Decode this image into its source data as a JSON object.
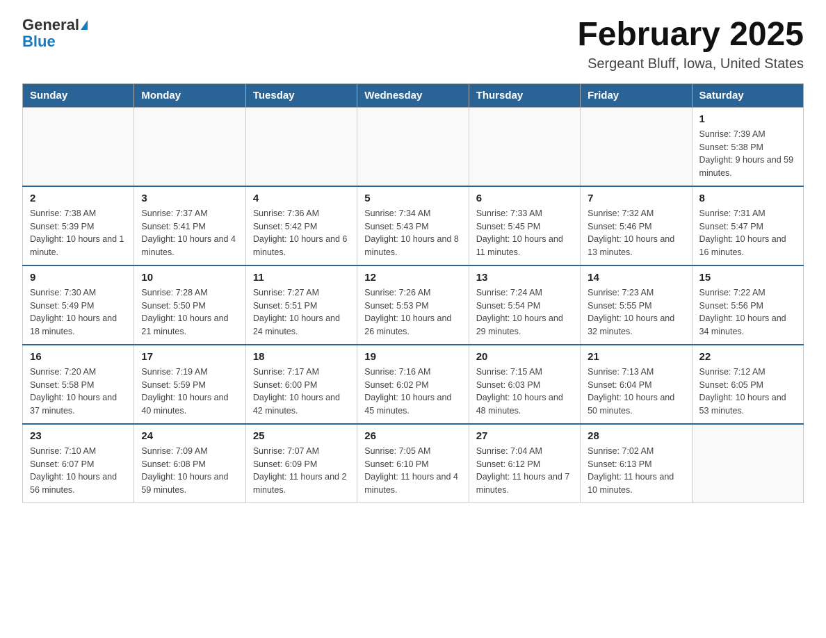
{
  "header": {
    "logo_line1": "General",
    "logo_line2": "Blue",
    "title": "February 2025",
    "subtitle": "Sergeant Bluff, Iowa, United States"
  },
  "calendar": {
    "days_of_week": [
      "Sunday",
      "Monday",
      "Tuesday",
      "Wednesday",
      "Thursday",
      "Friday",
      "Saturday"
    ],
    "weeks": [
      [
        {
          "day": "",
          "info": ""
        },
        {
          "day": "",
          "info": ""
        },
        {
          "day": "",
          "info": ""
        },
        {
          "day": "",
          "info": ""
        },
        {
          "day": "",
          "info": ""
        },
        {
          "day": "",
          "info": ""
        },
        {
          "day": "1",
          "info": "Sunrise: 7:39 AM\nSunset: 5:38 PM\nDaylight: 9 hours and 59 minutes."
        }
      ],
      [
        {
          "day": "2",
          "info": "Sunrise: 7:38 AM\nSunset: 5:39 PM\nDaylight: 10 hours and 1 minute."
        },
        {
          "day": "3",
          "info": "Sunrise: 7:37 AM\nSunset: 5:41 PM\nDaylight: 10 hours and 4 minutes."
        },
        {
          "day": "4",
          "info": "Sunrise: 7:36 AM\nSunset: 5:42 PM\nDaylight: 10 hours and 6 minutes."
        },
        {
          "day": "5",
          "info": "Sunrise: 7:34 AM\nSunset: 5:43 PM\nDaylight: 10 hours and 8 minutes."
        },
        {
          "day": "6",
          "info": "Sunrise: 7:33 AM\nSunset: 5:45 PM\nDaylight: 10 hours and 11 minutes."
        },
        {
          "day": "7",
          "info": "Sunrise: 7:32 AM\nSunset: 5:46 PM\nDaylight: 10 hours and 13 minutes."
        },
        {
          "day": "8",
          "info": "Sunrise: 7:31 AM\nSunset: 5:47 PM\nDaylight: 10 hours and 16 minutes."
        }
      ],
      [
        {
          "day": "9",
          "info": "Sunrise: 7:30 AM\nSunset: 5:49 PM\nDaylight: 10 hours and 18 minutes."
        },
        {
          "day": "10",
          "info": "Sunrise: 7:28 AM\nSunset: 5:50 PM\nDaylight: 10 hours and 21 minutes."
        },
        {
          "day": "11",
          "info": "Sunrise: 7:27 AM\nSunset: 5:51 PM\nDaylight: 10 hours and 24 minutes."
        },
        {
          "day": "12",
          "info": "Sunrise: 7:26 AM\nSunset: 5:53 PM\nDaylight: 10 hours and 26 minutes."
        },
        {
          "day": "13",
          "info": "Sunrise: 7:24 AM\nSunset: 5:54 PM\nDaylight: 10 hours and 29 minutes."
        },
        {
          "day": "14",
          "info": "Sunrise: 7:23 AM\nSunset: 5:55 PM\nDaylight: 10 hours and 32 minutes."
        },
        {
          "day": "15",
          "info": "Sunrise: 7:22 AM\nSunset: 5:56 PM\nDaylight: 10 hours and 34 minutes."
        }
      ],
      [
        {
          "day": "16",
          "info": "Sunrise: 7:20 AM\nSunset: 5:58 PM\nDaylight: 10 hours and 37 minutes."
        },
        {
          "day": "17",
          "info": "Sunrise: 7:19 AM\nSunset: 5:59 PM\nDaylight: 10 hours and 40 minutes."
        },
        {
          "day": "18",
          "info": "Sunrise: 7:17 AM\nSunset: 6:00 PM\nDaylight: 10 hours and 42 minutes."
        },
        {
          "day": "19",
          "info": "Sunrise: 7:16 AM\nSunset: 6:02 PM\nDaylight: 10 hours and 45 minutes."
        },
        {
          "day": "20",
          "info": "Sunrise: 7:15 AM\nSunset: 6:03 PM\nDaylight: 10 hours and 48 minutes."
        },
        {
          "day": "21",
          "info": "Sunrise: 7:13 AM\nSunset: 6:04 PM\nDaylight: 10 hours and 50 minutes."
        },
        {
          "day": "22",
          "info": "Sunrise: 7:12 AM\nSunset: 6:05 PM\nDaylight: 10 hours and 53 minutes."
        }
      ],
      [
        {
          "day": "23",
          "info": "Sunrise: 7:10 AM\nSunset: 6:07 PM\nDaylight: 10 hours and 56 minutes."
        },
        {
          "day": "24",
          "info": "Sunrise: 7:09 AM\nSunset: 6:08 PM\nDaylight: 10 hours and 59 minutes."
        },
        {
          "day": "25",
          "info": "Sunrise: 7:07 AM\nSunset: 6:09 PM\nDaylight: 11 hours and 2 minutes."
        },
        {
          "day": "26",
          "info": "Sunrise: 7:05 AM\nSunset: 6:10 PM\nDaylight: 11 hours and 4 minutes."
        },
        {
          "day": "27",
          "info": "Sunrise: 7:04 AM\nSunset: 6:12 PM\nDaylight: 11 hours and 7 minutes."
        },
        {
          "day": "28",
          "info": "Sunrise: 7:02 AM\nSunset: 6:13 PM\nDaylight: 11 hours and 10 minutes."
        },
        {
          "day": "",
          "info": ""
        }
      ]
    ]
  }
}
